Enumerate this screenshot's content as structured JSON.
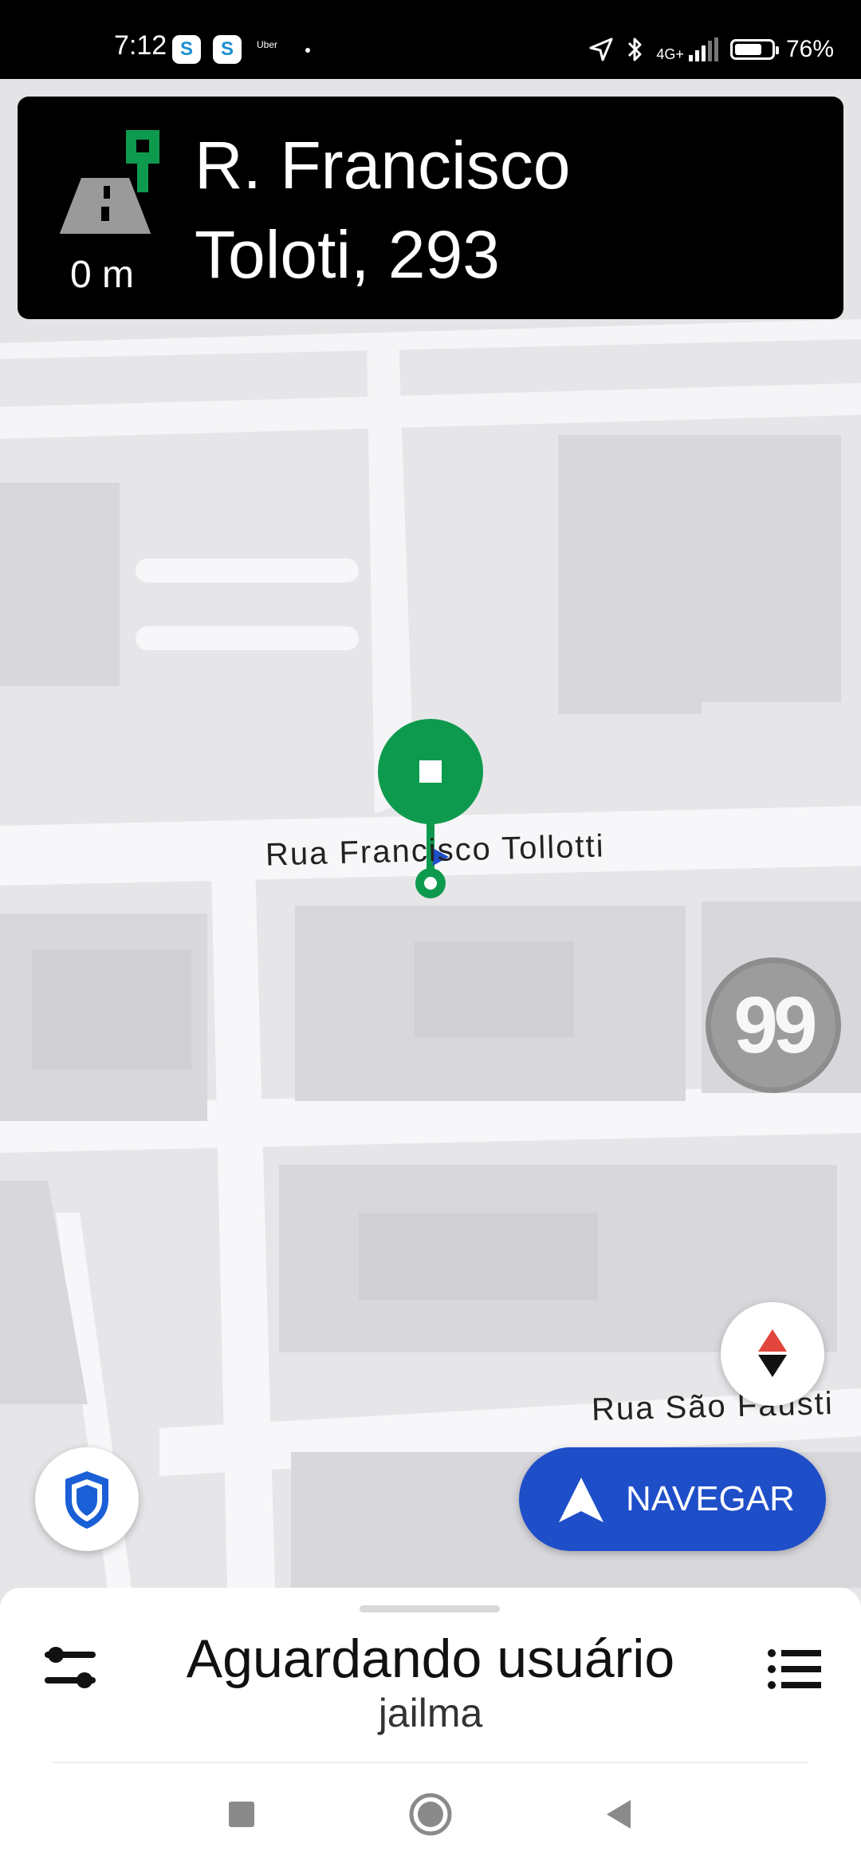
{
  "status_bar": {
    "time": "7:12",
    "app_badge_1": "S",
    "app_badge_2": "S",
    "uber_label": "Uber",
    "network": "4G+",
    "battery_text": "76%",
    "battery_level": 0.76
  },
  "nav_card": {
    "distance": "0 m",
    "street_line1": "R. Francisco",
    "street_line2": "Toloti, 293",
    "icons": [
      "road-icon",
      "destination-flag-icon"
    ]
  },
  "map": {
    "street_label_1": "Rua Francisco Tollotti",
    "street_label_2": "Rua São Fausti",
    "badge_99": "99"
  },
  "buttons": {
    "navegar_label": "NAVEGAR"
  },
  "sheet": {
    "title": "Aguardando usuário",
    "subtitle": "jailma"
  },
  "colors": {
    "route_green": "#0e9a4e",
    "navegar_blue": "#1f4ec9",
    "shield_blue": "#1a5fd6",
    "compass_red": "#e2453c"
  }
}
